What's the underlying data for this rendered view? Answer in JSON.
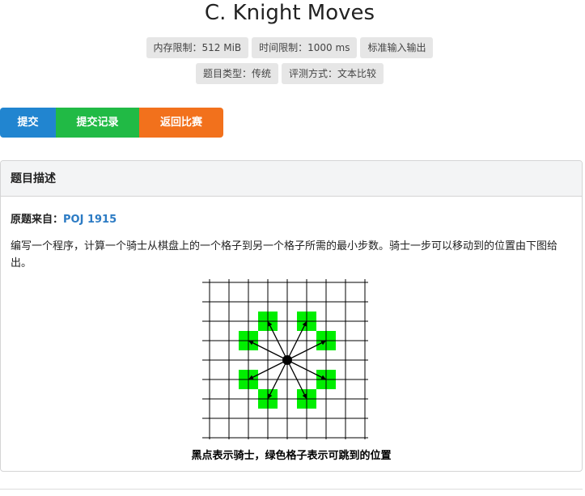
{
  "header": {
    "title": "C. Knight Moves",
    "badges_row1": [
      "内存限制：512 MiB",
      "时间限制：1000 ms",
      "标准输入输出"
    ],
    "badges_row2": [
      "题目类型：传统",
      "评测方式：文本比较"
    ]
  },
  "actions": {
    "submit": "提交",
    "submissions": "提交记录",
    "back": "返回比赛"
  },
  "panel": {
    "heading": "题目描述",
    "source_label": "原题来自：",
    "source_link": "POJ 1915",
    "description": "编写一个程序，计算一个骑士从棋盘上的一个格子到另一个格子所需的最小步数。骑士一步可以移动到的位置由下图给出。",
    "caption": "黑点表示骑士，绿色格子表示可跳到的位置"
  },
  "figure": {
    "grid_color": "#000000",
    "highlight_color": "#00ee00"
  }
}
